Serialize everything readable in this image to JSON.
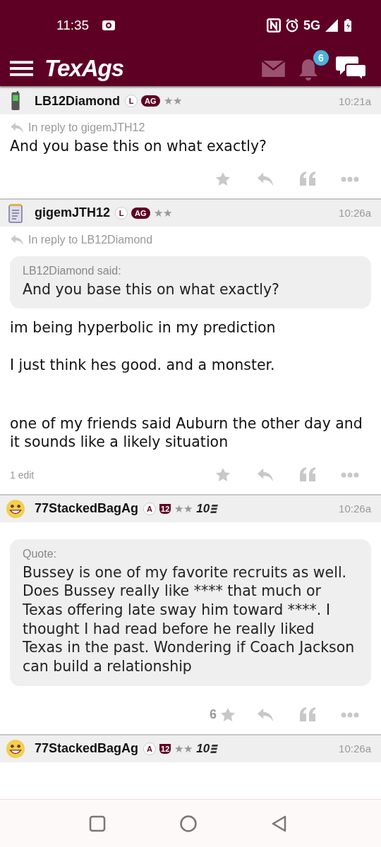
{
  "status_bar": {
    "time": "11:35",
    "network": "5G"
  },
  "app_bar": {
    "logo": "TexAgs",
    "notification_count": "6"
  },
  "posts": [
    {
      "avatar": {
        "kind": "phone"
      },
      "username": "LB12Diamond",
      "badges": [
        {
          "kind": "circle",
          "text": "L"
        },
        {
          "kind": "pill",
          "text": "AG"
        }
      ],
      "stars": "★★",
      "time": "10:21a",
      "reply_to": "In reply to gigemJTH12",
      "paragraphs": [
        "And you base this on what exactly?"
      ]
    },
    {
      "avatar": {
        "kind": "notepad"
      },
      "username": "gigemJTH12",
      "badges": [
        {
          "kind": "circle",
          "text": "L"
        },
        {
          "kind": "pill",
          "text": "AG"
        }
      ],
      "stars": "★★",
      "time": "10:26a",
      "reply_to": "In reply to LB12Diamond",
      "quote": {
        "author": "LB12Diamond said:",
        "text": "And you base this on what exactly?"
      },
      "paragraphs": [
        "im being hyperbolic in my prediction",
        "I just think hes good. and a monster.",
        "one of my friends said Auburn the other day and it sounds like a likely situation"
      ],
      "edit_note": "1 edit"
    },
    {
      "avatar": {
        "kind": "smiley"
      },
      "username": "77StackedBagAg",
      "badges": [
        {
          "kind": "circle",
          "text": "A"
        },
        {
          "kind": "shield",
          "text": "12"
        }
      ],
      "stars": "★★",
      "level_badge": "10",
      "time": "10:26a",
      "quote": {
        "author": "Quote:",
        "text": "Bussey is one of my favorite recruits as well. Does Bussey really like **** that much or Texas offering late sway him toward ****. I thought I had read before he really liked Texas in the past. Wondering if Coach Jackson can build a relationship"
      },
      "like_count": "6"
    },
    {
      "avatar": {
        "kind": "smiley"
      },
      "username": "77StackedBagAg",
      "badges": [
        {
          "kind": "circle",
          "text": "A"
        },
        {
          "kind": "shield",
          "text": "12"
        }
      ],
      "stars": "★★",
      "level_badge": "10",
      "time": "10:26a"
    }
  ]
}
